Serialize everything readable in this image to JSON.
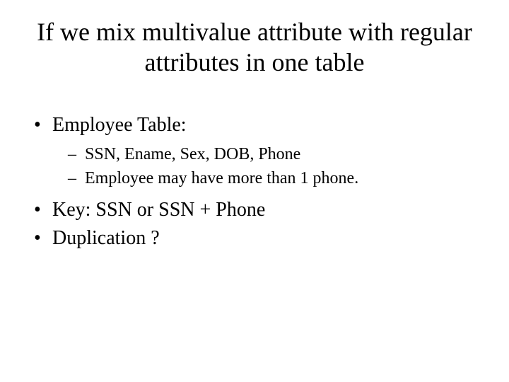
{
  "title": "If we mix multivalue attribute with regular attributes in one table",
  "bullets": [
    {
      "text": "Employee Table:",
      "children": [
        "SSN, Ename, Sex, DOB, Phone",
        "Employee may have more than 1 phone."
      ]
    },
    {
      "text": "Key: SSN or SSN + Phone"
    },
    {
      "text": "Duplication ?"
    }
  ]
}
